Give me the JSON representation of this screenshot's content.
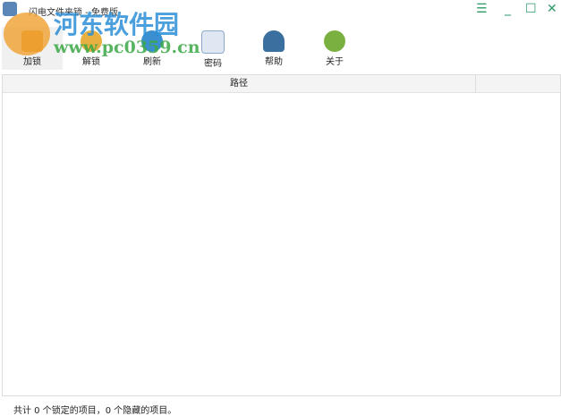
{
  "window": {
    "title": "闪电文件夹锁 - 免费版",
    "menu_icon": "☰",
    "minimize_icon": "_",
    "maximize_icon": "☐",
    "close_icon": "✕"
  },
  "toolbar": [
    {
      "label": "加锁",
      "icon": "lock-icon",
      "color": "#e0a030"
    },
    {
      "label": "解锁",
      "icon": "key-icon",
      "color": "#e8b040"
    },
    {
      "label": "刷新",
      "icon": "refresh-icon",
      "color": "#3a8fd0"
    },
    {
      "label": "密码",
      "icon": "password-icon",
      "color": "#8aa8c8"
    },
    {
      "label": "帮助",
      "icon": "help-agent-icon",
      "color": "#3a6fa0"
    },
    {
      "label": "关于",
      "icon": "info-icon",
      "color": "#7ab040"
    }
  ],
  "table": {
    "columns": [
      "路径",
      ""
    ]
  },
  "status": "共计 0 个锁定的项目，0 个隐藏的项目。",
  "watermark": {
    "line1": "河东软件园",
    "line2": "www.pc0359.cn"
  }
}
